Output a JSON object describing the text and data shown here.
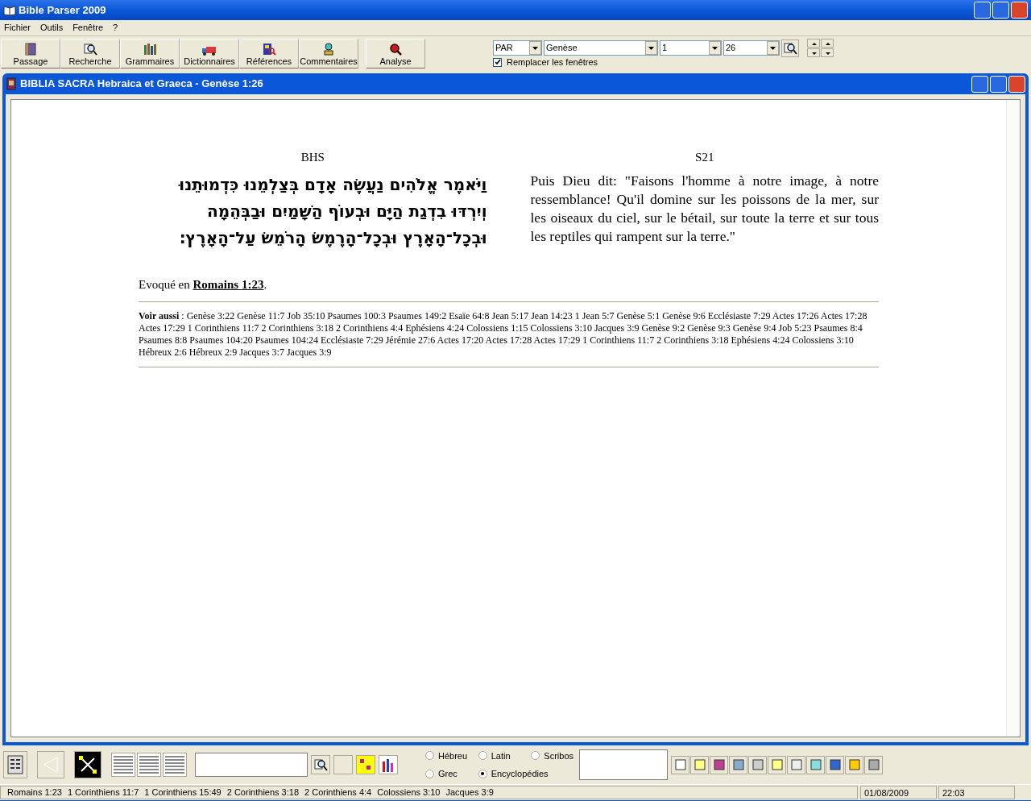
{
  "window": {
    "title": "Bible Parser 2009"
  },
  "menu": [
    "Fichier",
    "Outils",
    "Fenêtre",
    "?"
  ],
  "toolbar": [
    "Passage",
    "Recherche",
    "Grammaires",
    "Dictionnaires",
    "Références",
    "Commentaires",
    "Analyse"
  ],
  "navigator": {
    "version": "PAR",
    "book": "Genèse",
    "chapter": "1",
    "verse": "26",
    "replace_windows": {
      "label": "Remplacer les fenêtres",
      "checked": true
    }
  },
  "child_window": {
    "title": "BIBLIA SACRA Hebraica et Graeca - Genèse 1:26"
  },
  "columns": [
    {
      "heading": "BHS",
      "kind": "hebrew",
      "lines": [
        "וַיֹּאמֶר אֱלֹהִים נַעֲשֶׂה אָדָם בְּצַלְמֵנוּ כִּדְמוּתֵנוּ",
        "וְיִרְדּוּ בִדְגַת הַיָּם וּבְעוֹף הַשָּׁמַיִם וּבַבְּהֵמָה",
        "וּבְכָל־הָאָרֶץ וּבְכָל־הָרֶמֶשׂ הָרֹמֵשׂ עַל־הָאָרֶץ׃"
      ]
    },
    {
      "heading": "S21",
      "kind": "french",
      "lines": [
        "Puis Dieu dit: \"Faisons l'homme à notre image, à notre ressemblance! Qu'il domine sur les poissons de la mer, sur les oiseaux du ciel, sur le bétail, sur toute la terre et sur tous les reptiles qui rampent sur la terre.\""
      ]
    }
  ],
  "evoked": {
    "prefix": "Evoqué en",
    "link": "Romains 1:23",
    "suffix": "."
  },
  "see_also": "**Voir aussi** : Genèse 3:22 Genèse 11:7 Job 35:10 Psaumes 100:3 Psaumes 149:2 Esaïe 64:8 Jean 5:17 Jean 14:23 1 Jean 5:7 Genèse 5:1 Genèse 9:6 Ecclésiaste 7:29 Actes 17:26 Actes 17:28 Actes 17:29 1 Corinthiens 11:7 2 Corinthiens 3:18 2 Corinthiens 4:4 Ephésiens 4:24 Colossiens 1:15 Colossiens 3:10 Jacques 3:9 Genèse 9:2 Genèse 9:3 Genèse 9:4 Job 5:23 Psaumes 8:4 Psaumes 8:8 Psaumes 104:20 Psaumes 104:24 Ecclésiaste 7:29 Jérémie 27:6 Actes 17:20 Actes 17:28 Actes 17:29 1 Corinthiens 11:7 2 Corinthiens 3:18 Ephésiens 4:24 Colossiens 3:10 Hébreux 2:6 Hébreux 2:9 Jacques 3:7 Jacques 3:9",
  "languages": [
    {
      "label": "Hébreu",
      "selected": false
    },
    {
      "label": "Latin",
      "selected": false
    },
    {
      "label": "Scribos",
      "selected": false
    },
    {
      "label": "Grec",
      "selected": false
    },
    {
      "label": "Encyclopédies",
      "selected": true
    }
  ],
  "status_bar": {
    "references": [
      "Romains 1:23",
      "1 Corinthiens 11:7",
      "1 Corinthiens 15:49",
      "2 Corinthiens 3:18",
      "2 Corinthiens 4:4",
      "Colossiens 3:10",
      "Jacques 3:9"
    ],
    "date": "01/08/2009",
    "time": "22:03"
  }
}
